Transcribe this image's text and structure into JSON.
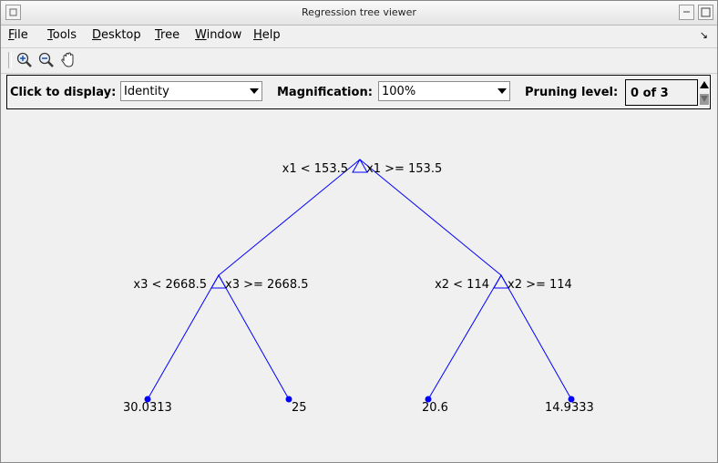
{
  "window": {
    "title": "Regression tree viewer"
  },
  "menu": {
    "items": [
      {
        "label": "File",
        "mnemonic": "F",
        "rest": "ile"
      },
      {
        "label": "Tools",
        "mnemonic": "T",
        "rest": "ools"
      },
      {
        "label": "Desktop",
        "mnemonic": "D",
        "rest": "esktop"
      },
      {
        "label": "Tree",
        "mnemonic": "T",
        "rest": "ree"
      },
      {
        "label": "Window",
        "mnemonic": "W",
        "rest": "indow"
      },
      {
        "label": "Help",
        "mnemonic": "H",
        "rest": "elp"
      }
    ]
  },
  "toolbar": {
    "tools": [
      {
        "icon": "zoom-in-icon"
      },
      {
        "icon": "zoom-out-icon"
      },
      {
        "icon": "pan-hand-icon"
      }
    ]
  },
  "controls": {
    "display_label": "Click to display:",
    "display_value": "Identity",
    "magnification_label": "Magnification:",
    "magnification_value": "100%",
    "pruning_label": "Pruning level:",
    "pruning_value": "0 of 3"
  },
  "tree": {
    "line_color": "#0000ff",
    "root": {
      "left_rule": "x1 < 153.5",
      "right_rule": "x1 >= 153.5"
    },
    "left": {
      "left_rule": "x3 < 2668.5",
      "right_rule": "x3 >= 2668.5"
    },
    "right": {
      "left_rule": "x2 < 114",
      "right_rule": "x2 >= 114"
    },
    "leaves": [
      "30.0313",
      "25",
      "20.6",
      "14.9333"
    ]
  }
}
